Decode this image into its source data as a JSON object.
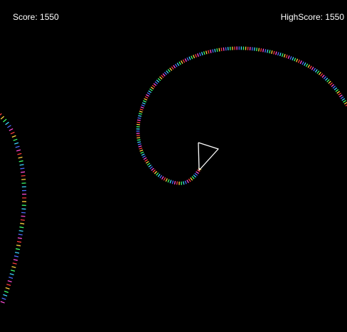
{
  "hud": {
    "score_label": "Score: 1550",
    "highscore_label": "HighScore: 1550"
  },
  "game": {
    "background_color": "#000000",
    "player_color": "#ffffff",
    "trail_palette": [
      "#ff3b3b",
      "#ffd23b",
      "#3bff6a",
      "#3bd7ff",
      "#4b6bff",
      "#ff4bd8"
    ]
  }
}
